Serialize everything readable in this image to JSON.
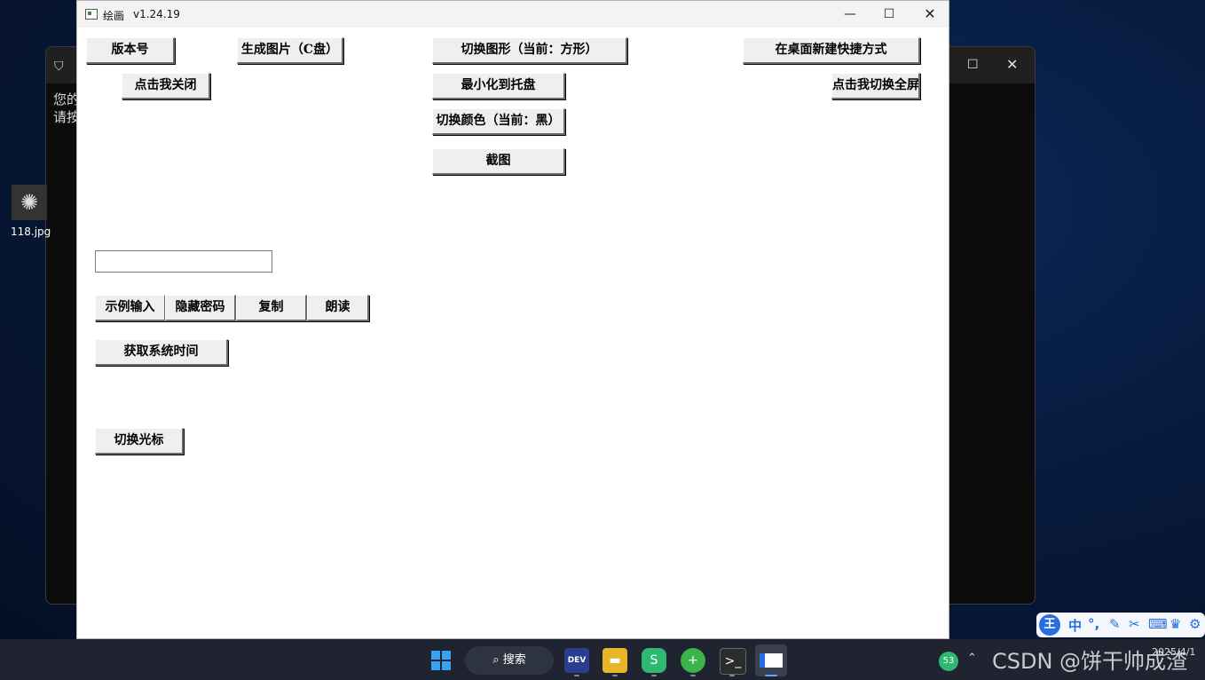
{
  "background_window": {
    "line1": "您的",
    "line2": "请按"
  },
  "desktop_icon": {
    "label": "118.jpg"
  },
  "window": {
    "title": "绘画",
    "version": "v1.24.19"
  },
  "buttons": {
    "version_no": "版本号",
    "gen_image": "生成图片（C盘）",
    "switch_shape": "切换图形（当前：方形）",
    "desktop_shortcut": "在桌面新建快捷方式",
    "close_me": "点击我关闭",
    "minimize_tray": "最小化到托盘",
    "toggle_fullscreen": "点击我切换全屏",
    "switch_color": "切换颜色（当前：黑）",
    "screenshot": "截图",
    "sample_input": "示例输入",
    "hide_password": "隐藏密码",
    "copy": "复制",
    "read_aloud": "朗读",
    "get_time": "获取系统时间",
    "switch_cursor": "切换光标"
  },
  "text_input": {
    "value": ""
  },
  "taskbar": {
    "search_label": "搜索",
    "badge_count": "53",
    "ime_lang": "中",
    "ime_logo": "王",
    "date": "2025/4/1"
  },
  "watermark": "CSDN @饼干帅成渣"
}
